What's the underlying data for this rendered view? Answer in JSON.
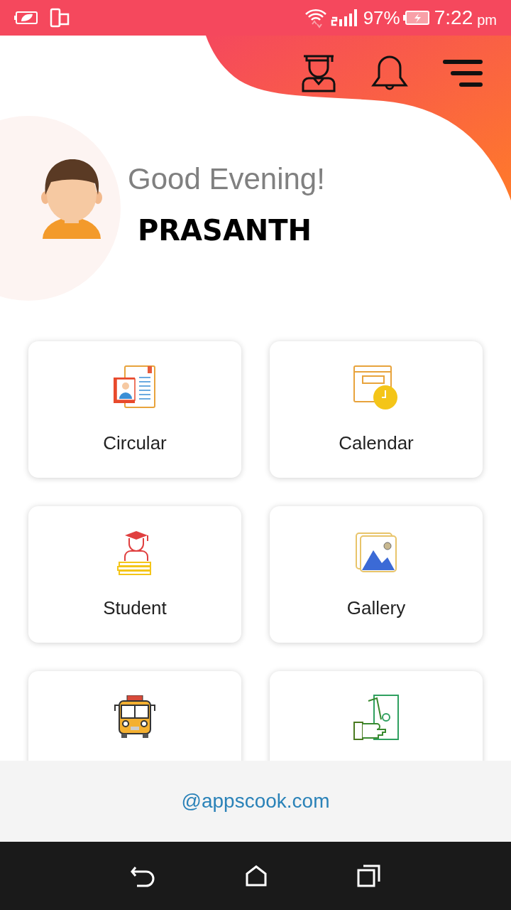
{
  "status_bar": {
    "battery": "97%",
    "time": "7:22",
    "meridiem": "pm"
  },
  "greeting": "Good Evening!",
  "user_name": "PRASANTH",
  "tiles": [
    {
      "label": "Circular"
    },
    {
      "label": "Calendar"
    },
    {
      "label": "Student"
    },
    {
      "label": "Gallery"
    }
  ],
  "footer": {
    "link": "@appscook.com"
  }
}
